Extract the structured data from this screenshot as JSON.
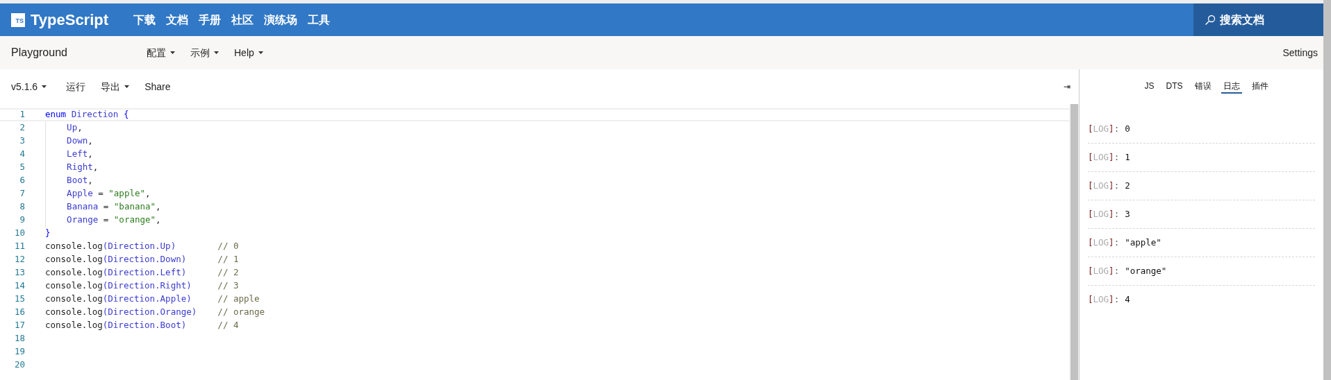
{
  "header": {
    "logo_mark": "TS",
    "brand": "TypeScript",
    "nav": [
      "下载",
      "文档",
      "手册",
      "社区",
      "演练场",
      "工具"
    ],
    "search": {
      "placeholder": "搜索文档"
    }
  },
  "subnav": {
    "title": "Playground",
    "menus": [
      "配置",
      "示例",
      "Help"
    ],
    "settings": "Settings"
  },
  "toolbar": {
    "version": "v5.1.6",
    "run": "运行",
    "export": "导出",
    "share": "Share",
    "collapse": "⇥"
  },
  "editor": {
    "lines": [
      {
        "number": "1",
        "current": true,
        "tokens": [
          {
            "text": "enum",
            "kind": "keyword"
          },
          {
            "text": " Direction ",
            "kind": "member"
          },
          {
            "text": "{",
            "kind": "keyword"
          }
        ]
      },
      {
        "number": "2",
        "current": false,
        "tokens": [
          {
            "text": "    Up",
            "kind": "member"
          },
          {
            "text": ",",
            "kind": "plain"
          }
        ]
      },
      {
        "number": "3",
        "current": false,
        "tokens": [
          {
            "text": "    Down",
            "kind": "member"
          },
          {
            "text": ",",
            "kind": "plain"
          }
        ]
      },
      {
        "number": "4",
        "current": false,
        "tokens": [
          {
            "text": "    Left",
            "kind": "member"
          },
          {
            "text": ",",
            "kind": "plain"
          }
        ]
      },
      {
        "number": "5",
        "current": false,
        "tokens": [
          {
            "text": "    Right",
            "kind": "member"
          },
          {
            "text": ",",
            "kind": "plain"
          }
        ]
      },
      {
        "number": "6",
        "current": false,
        "tokens": [
          {
            "text": "    Boot",
            "kind": "member"
          },
          {
            "text": ",",
            "kind": "plain"
          }
        ]
      },
      {
        "number": "7",
        "current": false,
        "tokens": [
          {
            "text": "    Apple",
            "kind": "member"
          },
          {
            "text": " = ",
            "kind": "plain"
          },
          {
            "text": "\"apple\"",
            "kind": "string"
          },
          {
            "text": ",",
            "kind": "plain"
          }
        ]
      },
      {
        "number": "8",
        "current": false,
        "tokens": [
          {
            "text": "    Banana",
            "kind": "member"
          },
          {
            "text": " = ",
            "kind": "plain"
          },
          {
            "text": "\"banana\"",
            "kind": "string"
          },
          {
            "text": ",",
            "kind": "plain"
          }
        ]
      },
      {
        "number": "9",
        "current": false,
        "tokens": [
          {
            "text": "    Orange",
            "kind": "member"
          },
          {
            "text": " = ",
            "kind": "plain"
          },
          {
            "text": "\"orange\"",
            "kind": "string"
          },
          {
            "text": ",",
            "kind": "plain"
          }
        ]
      },
      {
        "number": "10",
        "current": false,
        "tokens": [
          {
            "text": "}",
            "kind": "keyword"
          }
        ]
      },
      {
        "number": "11",
        "current": false,
        "tokens": [
          {
            "text": "console.log",
            "kind": "plain"
          },
          {
            "text": "(Direction.Up)",
            "kind": "member"
          },
          {
            "text": "        // 0",
            "kind": "comment"
          }
        ]
      },
      {
        "number": "12",
        "current": false,
        "tokens": [
          {
            "text": "console.log",
            "kind": "plain"
          },
          {
            "text": "(Direction.Down)",
            "kind": "member"
          },
          {
            "text": "      // 1",
            "kind": "comment"
          }
        ]
      },
      {
        "number": "13",
        "current": false,
        "tokens": [
          {
            "text": "console.log",
            "kind": "plain"
          },
          {
            "text": "(Direction.Left)",
            "kind": "member"
          },
          {
            "text": "      // 2",
            "kind": "comment"
          }
        ]
      },
      {
        "number": "14",
        "current": false,
        "tokens": [
          {
            "text": "console.log",
            "kind": "plain"
          },
          {
            "text": "(Direction.Right)",
            "kind": "member"
          },
          {
            "text": "     // 3",
            "kind": "comment"
          }
        ]
      },
      {
        "number": "15",
        "current": false,
        "tokens": [
          {
            "text": "console.log",
            "kind": "plain"
          },
          {
            "text": "(Direction.Apple)",
            "kind": "member"
          },
          {
            "text": "     // apple",
            "kind": "comment"
          }
        ]
      },
      {
        "number": "16",
        "current": false,
        "tokens": [
          {
            "text": "console.log",
            "kind": "plain"
          },
          {
            "text": "(Direction.Orange)",
            "kind": "member"
          },
          {
            "text": "    // orange",
            "kind": "comment"
          }
        ]
      },
      {
        "number": "17",
        "current": false,
        "tokens": [
          {
            "text": "console.log",
            "kind": "plain"
          },
          {
            "text": "(Direction.Boot)",
            "kind": "member"
          },
          {
            "text": "      // 4",
            "kind": "comment"
          }
        ]
      },
      {
        "number": "18",
        "current": false
      },
      {
        "number": "19",
        "current": false
      },
      {
        "number": "20",
        "current": false
      }
    ]
  },
  "output": {
    "tabs": [
      {
        "label": "JS",
        "selected": false
      },
      {
        "label": "DTS",
        "selected": false
      },
      {
        "label": "错误",
        "selected": false
      },
      {
        "label": "日志",
        "selected": true
      },
      {
        "label": "插件",
        "selected": false
      }
    ],
    "logs": [
      {
        "parts": [
          {
            "text": "[",
            "kind": "bracket"
          },
          {
            "text": "LOG",
            "kind": "tag"
          },
          {
            "text": "]",
            "kind": "bracket"
          },
          {
            "text": ":",
            "kind": "colon"
          },
          {
            "text": "0",
            "kind": "value"
          }
        ]
      },
      {
        "parts": [
          {
            "text": "[",
            "kind": "bracket"
          },
          {
            "text": "LOG",
            "kind": "tag"
          },
          {
            "text": "]",
            "kind": "bracket"
          },
          {
            "text": ":",
            "kind": "colon"
          },
          {
            "text": "1",
            "kind": "value"
          }
        ]
      },
      {
        "parts": [
          {
            "text": "[",
            "kind": "bracket"
          },
          {
            "text": "LOG",
            "kind": "tag"
          },
          {
            "text": "]",
            "kind": "bracket"
          },
          {
            "text": ":",
            "kind": "colon"
          },
          {
            "text": "2",
            "kind": "value"
          }
        ]
      },
      {
        "parts": [
          {
            "text": "[",
            "kind": "bracket"
          },
          {
            "text": "LOG",
            "kind": "tag"
          },
          {
            "text": "]",
            "kind": "bracket"
          },
          {
            "text": ":",
            "kind": "colon"
          },
          {
            "text": "3",
            "kind": "value"
          }
        ]
      },
      {
        "parts": [
          {
            "text": "[",
            "kind": "bracket"
          },
          {
            "text": "LOG",
            "kind": "tag"
          },
          {
            "text": "]",
            "kind": "bracket"
          },
          {
            "text": ":",
            "kind": "colon"
          },
          {
            "text": "\"apple\"",
            "kind": "value"
          }
        ]
      },
      {
        "parts": [
          {
            "text": "[",
            "kind": "bracket"
          },
          {
            "text": "LOG",
            "kind": "tag"
          },
          {
            "text": "]",
            "kind": "bracket"
          },
          {
            "text": ":",
            "kind": "colon"
          },
          {
            "text": "\"orange\"",
            "kind": "value"
          }
        ]
      },
      {
        "parts": [
          {
            "text": "[",
            "kind": "bracket"
          },
          {
            "text": "LOG",
            "kind": "tag"
          },
          {
            "text": "]",
            "kind": "bracket"
          },
          {
            "text": ":",
            "kind": "colon"
          },
          {
            "text": "4",
            "kind": "value"
          }
        ]
      }
    ]
  }
}
